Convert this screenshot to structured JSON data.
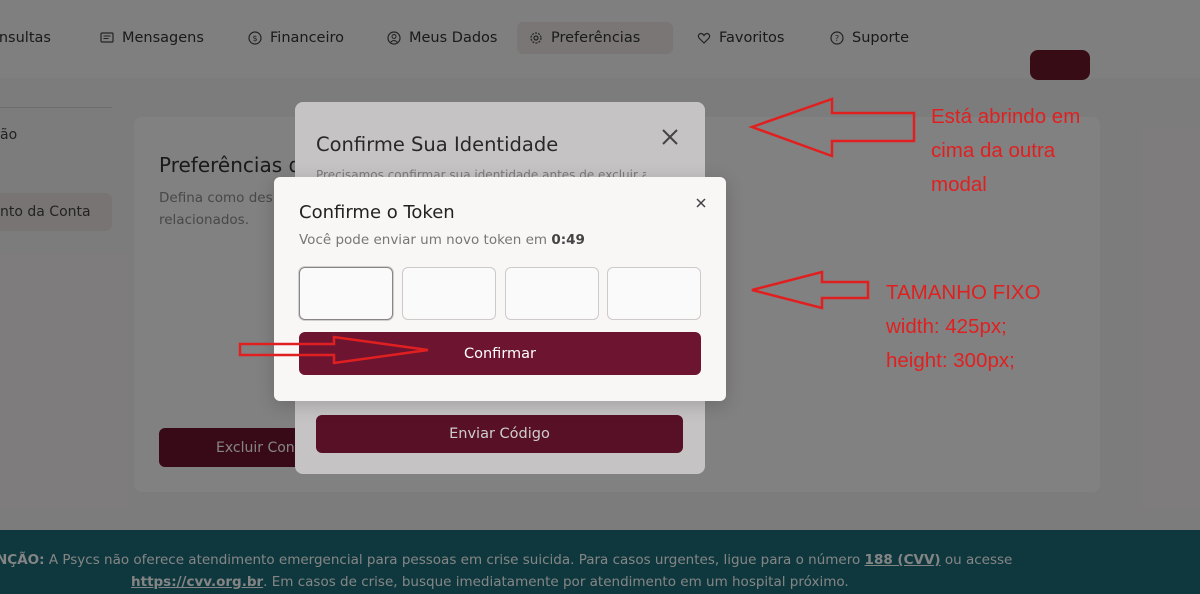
{
  "nav": {
    "items": [
      {
        "label": "onsultas",
        "icon": "calendar-icon"
      },
      {
        "label": "Mensagens",
        "icon": "message-icon"
      },
      {
        "label": "Financeiro",
        "icon": "dollar-circle-icon"
      },
      {
        "label": "Meus Dados",
        "icon": "user-circle-icon"
      },
      {
        "label": "Preferências",
        "icon": "gear-icon",
        "active": true
      },
      {
        "label": "Favoritos",
        "icon": "heart-icon"
      },
      {
        "label": "Suporte",
        "icon": "help-circle-icon"
      }
    ]
  },
  "sidebar": {
    "items": [
      {
        "label": "ão"
      },
      {
        "label": "nto da Conta",
        "active": true
      }
    ]
  },
  "card": {
    "title": "Preferências d",
    "description": "Defina como des\nrelacionados.",
    "danger_button": "Excluir Cont"
  },
  "modal_identity": {
    "title": "Confirme Sua Identidade",
    "description": "Precisamos confirmar sua identidade antes de excluir a",
    "send_button": "Enviar Código"
  },
  "modal_token": {
    "title": "Confirme o Token",
    "subtitle_prefix": "Você pode enviar um novo token em ",
    "timer": "0:49",
    "token_fields": [
      "",
      "",
      "",
      ""
    ],
    "confirm_button": "Confirmar"
  },
  "footer": {
    "line1_prefix": "NÇÃO:",
    "line1_text": " A Psycs não oferece atendimento emergencial para pessoas em crise suicida. Para casos urgentes, ligue para o número ",
    "line1_link": "188 (CVV)",
    "line1_suffix": " ou acesse",
    "line2_link": "https://cvv.org.br",
    "line2_text": ". Em casos de crise, busque imediatamente por atendimento em um hospital próximo."
  },
  "annotations": {
    "note1": [
      "Está abrindo em",
      "cima da outra",
      "modal"
    ],
    "note2": [
      "TAMANHO FIXO",
      "width: 425px;",
      "height: 300px;"
    ]
  },
  "colors": {
    "primary": "#6d1430",
    "footer_bg": "#1c6d78",
    "annotation": "#e02020"
  }
}
